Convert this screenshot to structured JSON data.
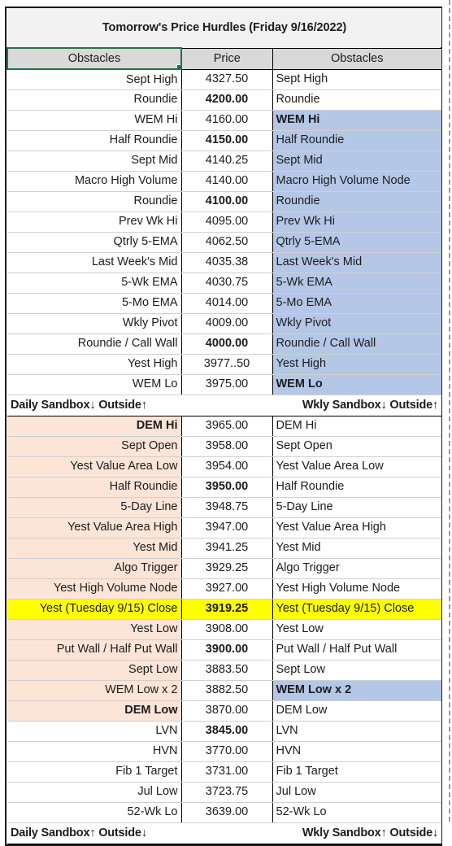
{
  "document": {
    "title": "Tomorrow's Price Hurdles (Friday 9/16/2022)"
  },
  "colors": {
    "title_text": "#3B5FA8",
    "title_fill": "#F2F2F2",
    "header_fill": "#D9D9D9",
    "weekly_sandbox_fill": "#B4C7E7",
    "daily_sandbox_fill": "#FCE4D6",
    "close_highlight_fill": "#FFFF00",
    "alert_text": "#C00000",
    "round_price_text": "#1F4E79",
    "selection_border": "#217346"
  },
  "header": {
    "col_left": "Obstacles",
    "col_price": "Price",
    "col_right": "Obstacles"
  },
  "dividers": {
    "upper_left": "Daily Sandbox↓ Outside↑",
    "upper_right": "Wkly Sandbox↓ Outside↑",
    "lower_left": "Daily Sandbox↑ Outside↓",
    "lower_right": "Wkly Sandbox↑ Outside↓"
  },
  "rows_upper": [
    {
      "left": "Sept High",
      "price": "4327.50",
      "right": "Sept High",
      "lfill": "white",
      "rfill": "white",
      "pstyle": "",
      "lstyle": "",
      "rstyle": ""
    },
    {
      "left": "Roundie",
      "price": "4200.00",
      "right": "Roundie",
      "lfill": "white",
      "rfill": "white",
      "pstyle": "blue",
      "lstyle": "",
      "rstyle": ""
    },
    {
      "left": "WEM Hi",
      "price": "4160.00",
      "right": "WEM Hi",
      "lfill": "white",
      "rfill": "blue",
      "pstyle": "",
      "lstyle": "",
      "rstyle": "red"
    },
    {
      "left": "Half Roundie",
      "price": "4150.00",
      "right": "Half Roundie",
      "lfill": "white",
      "rfill": "blue",
      "pstyle": "blue",
      "lstyle": "",
      "rstyle": ""
    },
    {
      "left": "Sept Mid",
      "price": "4140.25",
      "right": "Sept Mid",
      "lfill": "white",
      "rfill": "blue",
      "pstyle": "",
      "lstyle": "",
      "rstyle": ""
    },
    {
      "left": "Macro High Volume",
      "price": "4140.00",
      "right": "Macro High Volume Node",
      "lfill": "white",
      "rfill": "blue",
      "pstyle": "",
      "lstyle": "",
      "rstyle": ""
    },
    {
      "left": "Roundie",
      "price": "4100.00",
      "right": "Roundie",
      "lfill": "white",
      "rfill": "blue",
      "pstyle": "blue",
      "lstyle": "",
      "rstyle": ""
    },
    {
      "left": "Prev Wk Hi",
      "price": "4095.00",
      "right": "Prev Wk Hi",
      "lfill": "white",
      "rfill": "blue",
      "pstyle": "",
      "lstyle": "",
      "rstyle": ""
    },
    {
      "left": "Qtrly 5-EMA",
      "price": "4062.50",
      "right": "Qtrly 5-EMA",
      "lfill": "white",
      "rfill": "blue",
      "pstyle": "",
      "lstyle": "",
      "rstyle": ""
    },
    {
      "left": "Last Week's Mid",
      "price": "4035.38",
      "right": "Last Week's Mid",
      "lfill": "white",
      "rfill": "blue",
      "pstyle": "",
      "lstyle": "",
      "rstyle": ""
    },
    {
      "left": "5-Wk EMA",
      "price": "4030.75",
      "right": "5-Wk EMA",
      "lfill": "white",
      "rfill": "blue",
      "pstyle": "",
      "lstyle": "",
      "rstyle": ""
    },
    {
      "left": "5-Mo EMA",
      "price": "4014.00",
      "right": "5-Mo EMA",
      "lfill": "white",
      "rfill": "blue",
      "pstyle": "",
      "lstyle": "",
      "rstyle": ""
    },
    {
      "left": "Wkly Pivot",
      "price": "4009.00",
      "right": "Wkly Pivot",
      "lfill": "white",
      "rfill": "blue",
      "pstyle": "",
      "lstyle": "",
      "rstyle": ""
    },
    {
      "left": "Roundie / Call Wall",
      "price": "4000.00",
      "right": "Roundie / Call Wall",
      "lfill": "white",
      "rfill": "blue",
      "pstyle": "blue",
      "lstyle": "",
      "rstyle": ""
    },
    {
      "left": "Yest High",
      "price": "3977..50",
      "right": "Yest High",
      "lfill": "white",
      "rfill": "blue",
      "pstyle": "",
      "lstyle": "",
      "rstyle": ""
    },
    {
      "left": "WEM Lo",
      "price": "3975.00",
      "right": "WEM Lo",
      "lfill": "white",
      "rfill": "blue",
      "pstyle": "",
      "lstyle": "",
      "rstyle": "red"
    }
  ],
  "rows_lower": [
    {
      "left": "DEM Hi",
      "price": "3965.00",
      "right": "DEM Hi",
      "lfill": "peach",
      "rfill": "white",
      "pstyle": "",
      "lstyle": "red",
      "rstyle": ""
    },
    {
      "left": "Sept Open",
      "price": "3958.00",
      "right": "Sept Open",
      "lfill": "peach",
      "rfill": "white",
      "pstyle": "",
      "lstyle": "",
      "rstyle": ""
    },
    {
      "left": "Yest Value Area Low",
      "price": "3954.00",
      "right": "Yest Value Area Low",
      "lfill": "peach",
      "rfill": "white",
      "pstyle": "",
      "lstyle": "",
      "rstyle": ""
    },
    {
      "left": "Half Roundie",
      "price": "3950.00",
      "right": "Half Roundie",
      "lfill": "peach",
      "rfill": "white",
      "pstyle": "blue",
      "lstyle": "",
      "rstyle": ""
    },
    {
      "left": "5-Day Line",
      "price": "3948.75",
      "right": "5-Day Line",
      "lfill": "peach",
      "rfill": "white",
      "pstyle": "",
      "lstyle": "",
      "rstyle": ""
    },
    {
      "left": "Yest Value Area High",
      "price": "3947.00",
      "right": "Yest Value Area High",
      "lfill": "peach",
      "rfill": "white",
      "pstyle": "",
      "lstyle": "",
      "rstyle": ""
    },
    {
      "left": "Yest Mid",
      "price": "3941.25",
      "right": "Yest Mid",
      "lfill": "peach",
      "rfill": "white",
      "pstyle": "",
      "lstyle": "",
      "rstyle": ""
    },
    {
      "left": "Algo Trigger",
      "price": "3929.25",
      "right": "Algo Trigger",
      "lfill": "peach",
      "rfill": "white",
      "pstyle": "",
      "lstyle": "",
      "rstyle": ""
    },
    {
      "left": "Yest High Volume Node",
      "price": "3927.00",
      "right": "Yest High Volume Node",
      "lfill": "peach",
      "rfill": "white",
      "pstyle": "",
      "lstyle": "",
      "rstyle": ""
    },
    {
      "left": "Yest (Tuesday 9/15) Close",
      "price": "3919.25",
      "right": "Yest (Tuesday 9/15) Close",
      "lfill": "yellow",
      "rfill": "yellow",
      "pstyle": "bold",
      "lstyle": "",
      "rstyle": "yellowpad"
    },
    {
      "left": "Yest Low",
      "price": "3908.00",
      "right": "Yest Low",
      "lfill": "peach",
      "rfill": "white",
      "pstyle": "",
      "lstyle": "",
      "rstyle": ""
    },
    {
      "left": "Put Wall / Half Put Wall",
      "price": "3900.00",
      "right": "Put Wall / Half Put Wall",
      "lfill": "peach",
      "rfill": "white",
      "pstyle": "blue",
      "lstyle": "",
      "rstyle": ""
    },
    {
      "left": "Sept Low",
      "price": "3883.50",
      "right": "Sept Low",
      "lfill": "peach",
      "rfill": "white",
      "pstyle": "",
      "lstyle": "",
      "rstyle": ""
    },
    {
      "left": "WEM Low x 2",
      "price": "3882.50",
      "right": "WEM Low x 2",
      "lfill": "peach",
      "rfill": "blue",
      "pstyle": "",
      "lstyle": "",
      "rstyle": "red"
    },
    {
      "left": "DEM Low",
      "price": "3870.00",
      "right": "DEM Low",
      "lfill": "peach",
      "rfill": "white",
      "pstyle": "",
      "lstyle": "red",
      "rstyle": ""
    },
    {
      "left": "LVN",
      "price": "3845.00",
      "right": "LVN",
      "lfill": "white",
      "rfill": "white",
      "pstyle": "blue",
      "lstyle": "",
      "rstyle": ""
    },
    {
      "left": "HVN",
      "price": "3770.00",
      "right": "HVN",
      "lfill": "white",
      "rfill": "white",
      "pstyle": "",
      "lstyle": "",
      "rstyle": ""
    },
    {
      "left": "Fib 1 Target",
      "price": "3731.00",
      "right": "Fib 1 Target",
      "lfill": "white",
      "rfill": "white",
      "pstyle": "",
      "lstyle": "",
      "rstyle": ""
    },
    {
      "left": "Jul Low",
      "price": "3723.75",
      "right": "Jul Low",
      "lfill": "white",
      "rfill": "white",
      "pstyle": "",
      "lstyle": "",
      "rstyle": ""
    },
    {
      "left": "52-Wk Lo",
      "price": "3639.00",
      "right": "52-Wk Lo",
      "lfill": "white",
      "rfill": "white",
      "pstyle": "",
      "lstyle": "",
      "rstyle": ""
    }
  ]
}
